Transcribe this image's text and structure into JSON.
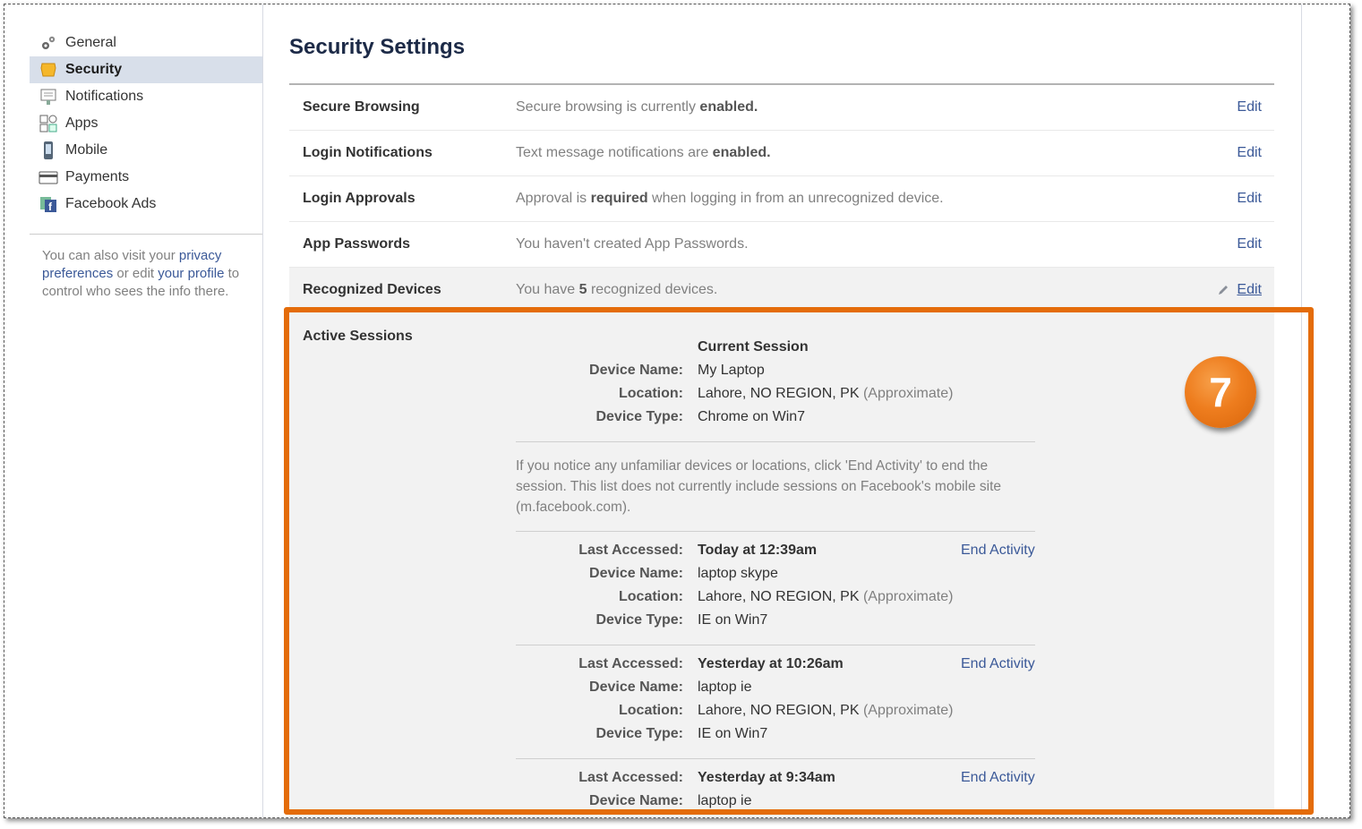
{
  "sidebar": {
    "items": [
      {
        "label": "General",
        "icon": "gears-icon",
        "active": false
      },
      {
        "label": "Security",
        "icon": "badge-icon",
        "active": true
      },
      {
        "label": "Notifications",
        "icon": "notifications-icon",
        "active": false
      },
      {
        "label": "Apps",
        "icon": "apps-icon",
        "active": false
      },
      {
        "label": "Mobile",
        "icon": "mobile-icon",
        "active": false
      },
      {
        "label": "Payments",
        "icon": "credit-card-icon",
        "active": false
      },
      {
        "label": "Facebook Ads",
        "icon": "facebook-ads-icon",
        "active": false
      }
    ],
    "note": {
      "text1": "You can also visit your ",
      "link1": "privacy preferences",
      "text2": " or edit ",
      "link2": "your profile",
      "text3": " to control who sees the info there."
    }
  },
  "main": {
    "title": "Security Settings",
    "edit_label": "Edit",
    "rows": [
      {
        "label": "Secure Browsing",
        "desc_pre": "Secure browsing is currently ",
        "desc_bold": "enabled.",
        "desc_post": ""
      },
      {
        "label": "Login Notifications",
        "desc_pre": "Text message notifications are ",
        "desc_bold": "enabled.",
        "desc_post": ""
      },
      {
        "label": "Login Approvals",
        "desc_pre": "Approval is ",
        "desc_bold": "required",
        "desc_post": " when logging in from an unrecognized device."
      },
      {
        "label": "App Passwords",
        "desc_pre": "You haven't created App Passwords.",
        "desc_bold": "",
        "desc_post": ""
      },
      {
        "label": "Recognized Devices",
        "desc_pre": "You have ",
        "desc_bold": "5",
        "desc_post": " recognized devices."
      }
    ]
  },
  "sessions": {
    "label": "Active Sessions",
    "current": {
      "heading": "Current Session",
      "device_name_key": "Device Name:",
      "device_name": "My Laptop",
      "location_key": "Location:",
      "location": "Lahore, NO REGION, PK",
      "approx": "(Approximate)",
      "device_type_key": "Device Type:",
      "device_type": "Chrome on Win7"
    },
    "notice": "If you notice any unfamiliar devices or locations, click 'End Activity' to end the session. This list does not currently include sessions on Facebook's mobile site (m.facebook.com).",
    "end_activity": "End Activity",
    "keys": {
      "last_accessed": "Last Accessed:",
      "device_name": "Device Name:",
      "location": "Location:",
      "device_type": "Device Type:"
    },
    "approx": "(Approximate)",
    "list": [
      {
        "last_accessed": "Today at 12:39am",
        "device_name": "laptop skype",
        "location": "Lahore, NO REGION, PK",
        "device_type": "IE on Win7"
      },
      {
        "last_accessed": "Yesterday at 10:26am",
        "device_name": "laptop ie",
        "location": "Lahore, NO REGION, PK",
        "device_type": "IE on Win7"
      },
      {
        "last_accessed": "Yesterday at 9:34am",
        "device_name": "laptop ie"
      }
    ]
  },
  "callout": {
    "number": "7",
    "color": "#e46c0a"
  }
}
